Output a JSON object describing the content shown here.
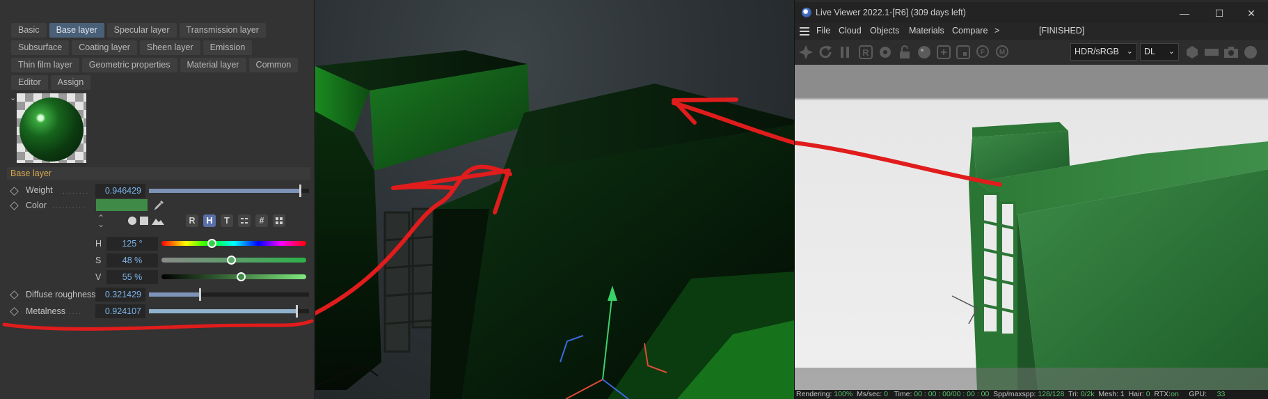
{
  "tabs": {
    "row1": [
      "Basic",
      "Base layer",
      "Specular layer",
      "Transmission layer"
    ],
    "row2": [
      "Subsurface",
      "Coating layer",
      "Sheen layer",
      "Emission"
    ],
    "row3": [
      "Thin film layer",
      "Geometric properties",
      "Material layer",
      "Common"
    ],
    "row4": [
      "Editor",
      "Assign"
    ],
    "active": "Base layer"
  },
  "section": {
    "title": "Base layer"
  },
  "props": {
    "weight": {
      "label": "Weight",
      "value": "0.946429",
      "fraction": 0.946
    },
    "color": {
      "label": "Color",
      "hex": "#3f8a47"
    },
    "diffuse_roughness": {
      "label": "Diffuse roughness",
      "value": "0.321429",
      "fraction": 0.321
    },
    "metalness": {
      "label": "Metalness",
      "value": "0.924107",
      "fraction": 0.924
    }
  },
  "color_modes": [
    "R",
    "H",
    "T",
    "#"
  ],
  "color_mode_active": "H",
  "hsv": {
    "h": {
      "label": "H",
      "value": "125 °",
      "fraction": 0.347
    },
    "s": {
      "label": "S",
      "value": "48 %",
      "fraction": 0.48
    },
    "v": {
      "label": "V",
      "value": "55 %",
      "fraction": 0.55
    }
  },
  "live_viewer": {
    "title": "Live Viewer 2022.1-[R6] (309 days left)",
    "menus": [
      "File",
      "Cloud",
      "Objects",
      "Materials",
      "Compare",
      ">"
    ],
    "status": "[FINISHED]",
    "color_space": "HDR/sRGB",
    "kernel": "DL",
    "statusbar": {
      "rendering_label": "Rendering:",
      "rendering_value": "100%",
      "ms_label": "Ms/sec:",
      "ms_value": "0",
      "time_label": "Time:",
      "time_value": "00 : 00 : 00/00 : 00 : 00",
      "spp_label": "Spp/maxspp:",
      "spp_value": "128/128",
      "tri_label": "Tri:",
      "tri_value": "0/2k",
      "mesh_label": "Mesh:",
      "mesh_value": "1",
      "hair_label": "Hair:",
      "hair_value": "0",
      "rtx_label": "RTX:",
      "rtx_value": "on",
      "gpu_label": "GPU:",
      "gpu_value": "33"
    }
  },
  "colors": {
    "accent_tab": "#4a5f78",
    "value_text": "#7cb4ea",
    "section_header": "#d8a84f",
    "annotation": "#e01c1c",
    "material_green": "#3f8a47"
  },
  "icons": {
    "eyedropper": "eyedropper-icon",
    "hamburger": "hamburger-icon",
    "minimize": "minimize-icon",
    "maximize": "maximize-icon",
    "close": "close-icon"
  }
}
